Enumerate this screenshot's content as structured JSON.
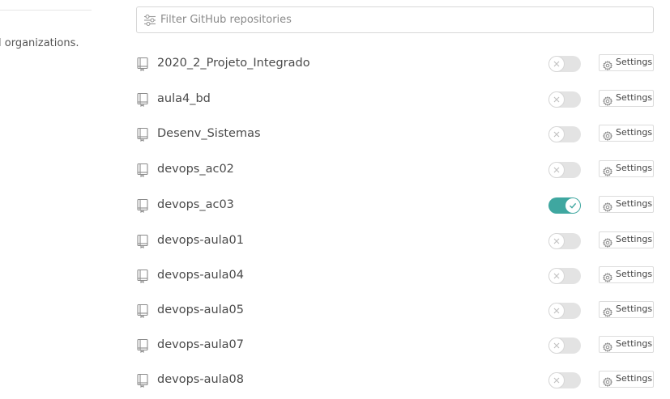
{
  "left_panel": {
    "text": "l organizations."
  },
  "filter": {
    "placeholder": "Filter GitHub repositories",
    "value": ""
  },
  "repositories": [
    {
      "name": "2020_2_Projeto_Integrado",
      "enabled": false,
      "settings_label": "Settings"
    },
    {
      "name": "aula4_bd",
      "enabled": false,
      "settings_label": "Settings"
    },
    {
      "name": "Desenv_Sistemas",
      "enabled": false,
      "settings_label": "Settings"
    },
    {
      "name": "devops_ac02",
      "enabled": false,
      "settings_label": "Settings"
    },
    {
      "name": "devops_ac03",
      "enabled": true,
      "settings_label": "Settings"
    },
    {
      "name": "devops-aula01",
      "enabled": false,
      "settings_label": "Settings"
    },
    {
      "name": "devops-aula04",
      "enabled": false,
      "settings_label": "Settings"
    },
    {
      "name": "devops-aula05",
      "enabled": false,
      "settings_label": "Settings"
    },
    {
      "name": "devops-aula07",
      "enabled": false,
      "settings_label": "Settings"
    },
    {
      "name": "devops-aula08",
      "enabled": false,
      "settings_label": "Settings"
    }
  ],
  "colors": {
    "toggle_on": "#3fa7a0",
    "toggle_off": "#e3e3e3"
  },
  "icons": {
    "filter": "sliders-icon",
    "repo": "repo-book-icon",
    "settings": "gear-icon",
    "toggle_on": "check-icon",
    "toggle_off": "x-icon"
  }
}
